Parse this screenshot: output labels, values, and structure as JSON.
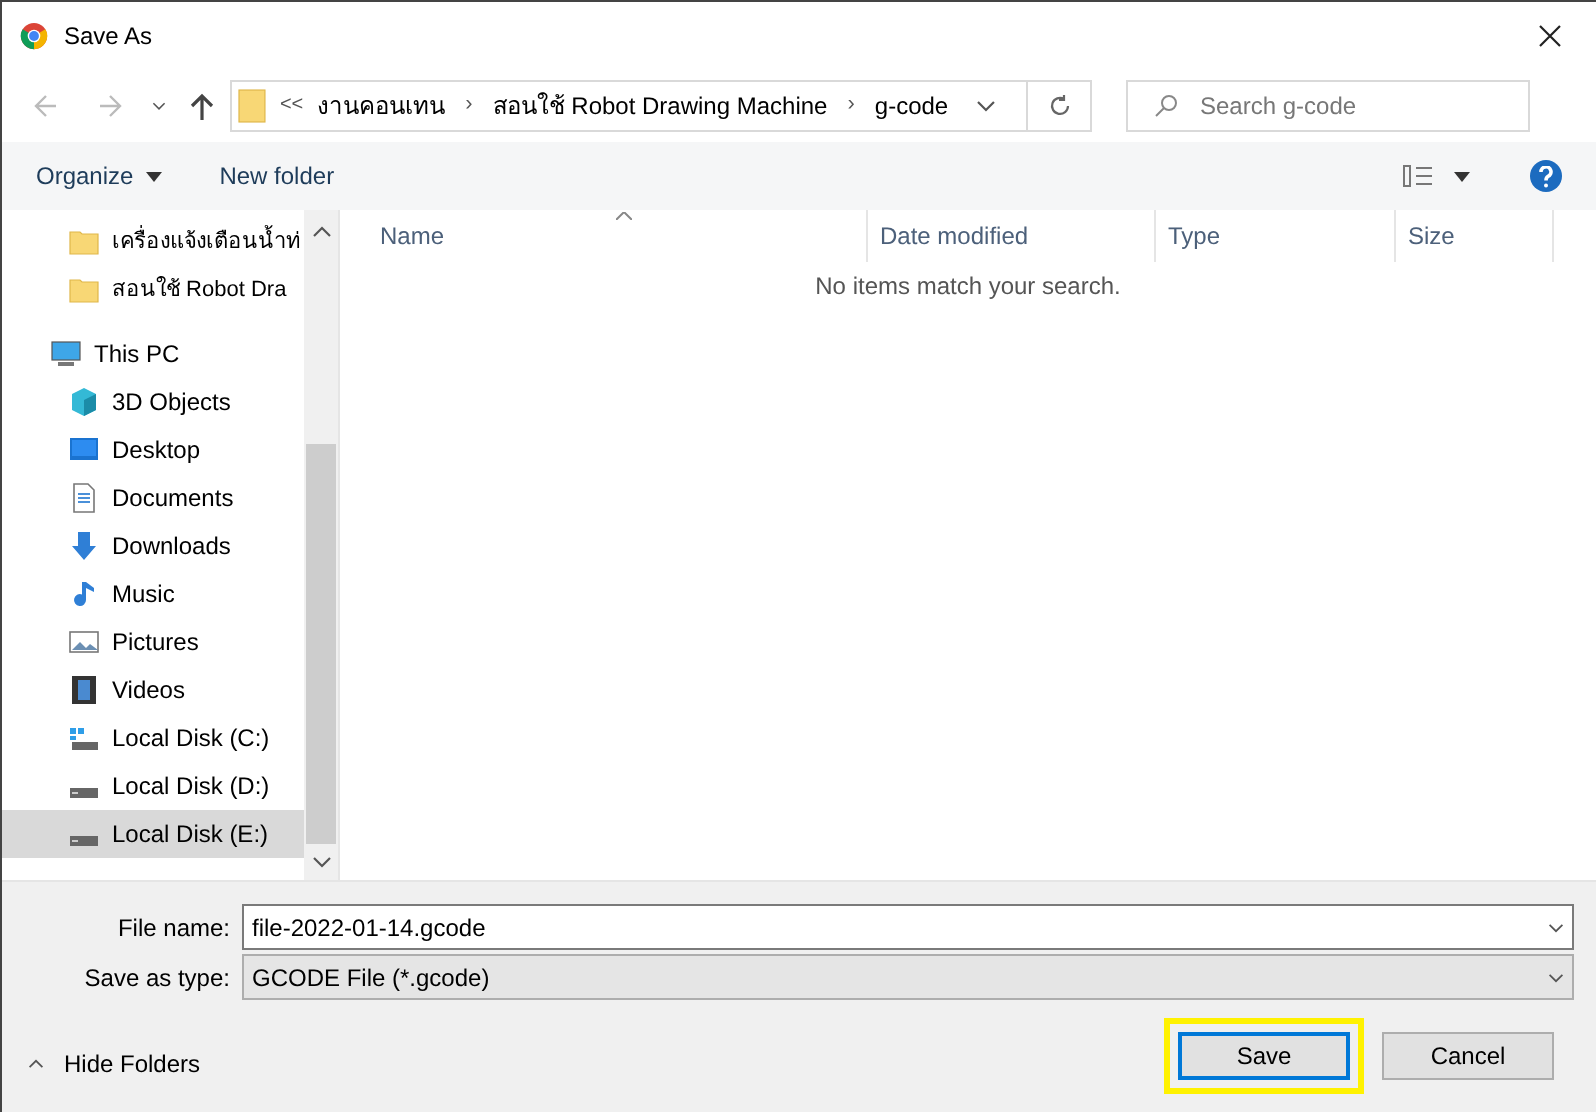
{
  "window": {
    "title": "Save As"
  },
  "address": {
    "overflow": "<<",
    "separator": "›",
    "crumbs": [
      "งานคอนเทน",
      "สอนใช้ Robot Drawing Machine",
      "g-code"
    ]
  },
  "search": {
    "placeholder": "Search g-code"
  },
  "toolbar": {
    "organize": "Organize",
    "new_folder": "New folder"
  },
  "sidebar": {
    "items": [
      {
        "label": "เครื่องแจ้งเตือนน้ำท่",
        "kind": "folder",
        "selected": false
      },
      {
        "label": "สอนใช้ Robot Dra",
        "kind": "folder",
        "selected": false
      },
      {
        "label": "This PC",
        "kind": "pc",
        "selected": false,
        "children": [
          {
            "label": "3D Objects",
            "kind": "objects",
            "selected": false
          },
          {
            "label": "Desktop",
            "kind": "desktop",
            "selected": false
          },
          {
            "label": "Documents",
            "kind": "documents",
            "selected": false
          },
          {
            "label": "Downloads",
            "kind": "downloads",
            "selected": false
          },
          {
            "label": "Music",
            "kind": "music",
            "selected": false
          },
          {
            "label": "Pictures",
            "kind": "pictures",
            "selected": false
          },
          {
            "label": "Videos",
            "kind": "videos",
            "selected": false
          },
          {
            "label": "Local Disk (C:)",
            "kind": "system-disk",
            "selected": false
          },
          {
            "label": "Local Disk (D:)",
            "kind": "disk",
            "selected": false
          },
          {
            "label": "Local Disk (E:)",
            "kind": "disk",
            "selected": true
          }
        ]
      }
    ]
  },
  "table": {
    "columns": [
      "Name",
      "Date modified",
      "Type",
      "Size"
    ],
    "empty_message": "No items match your search."
  },
  "form": {
    "file_name_label": "File name:",
    "file_name": "file-2022-01-14.gcode",
    "type_label": "Save as type:",
    "type": "GCODE File (*.gcode)"
  },
  "hide_folders": "Hide Folders",
  "buttons": [
    {
      "label": "Save",
      "kind": "primary",
      "highlighted": true
    },
    {
      "label": "Cancel",
      "kind": "normal",
      "highlighted": false
    }
  ]
}
